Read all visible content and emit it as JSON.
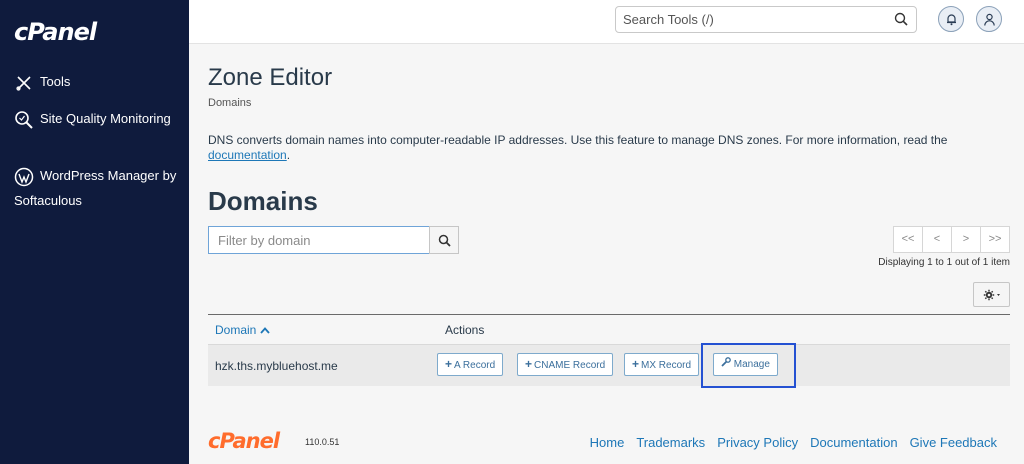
{
  "sidebar": {
    "logo": "cPanel",
    "items": [
      {
        "label": "Tools"
      },
      {
        "label": "Site Quality Monitoring"
      },
      {
        "label": "WordPress Manager by Softaculous"
      }
    ]
  },
  "header": {
    "search_placeholder": "Search Tools (/)"
  },
  "page": {
    "title": "Zone Editor",
    "breadcrumb": "Domains",
    "description": "DNS converts domain names into computer-readable IP addresses. Use this feature to manage DNS zones. For more information, read the",
    "description_link": "documentation",
    "description_end": ".",
    "section_title": "Domains"
  },
  "filter": {
    "placeholder": "Filter by domain"
  },
  "pager": {
    "first": "<<",
    "prev": "<",
    "next": ">",
    "last": ">>",
    "displaying": "Displaying 1 to 1 out of 1 item"
  },
  "table": {
    "col_domain": "Domain",
    "col_actions": "Actions",
    "rows": [
      {
        "domain": "hzk.ths.mybluehost.me",
        "a_record": "A Record",
        "cname_record": "CNAME Record",
        "mx_record": "MX Record",
        "manage": "Manage"
      }
    ]
  },
  "footer": {
    "logo": "cPanel",
    "version": "110.0.51",
    "links": [
      "Home",
      "Trademarks",
      "Privacy Policy",
      "Documentation",
      "Give Feedback"
    ]
  },
  "colors": {
    "sidebar_bg": "#0f1b3d",
    "link": "#1d77b7",
    "brand_orange": "#ff6c2c",
    "highlight": "#2451d2"
  }
}
